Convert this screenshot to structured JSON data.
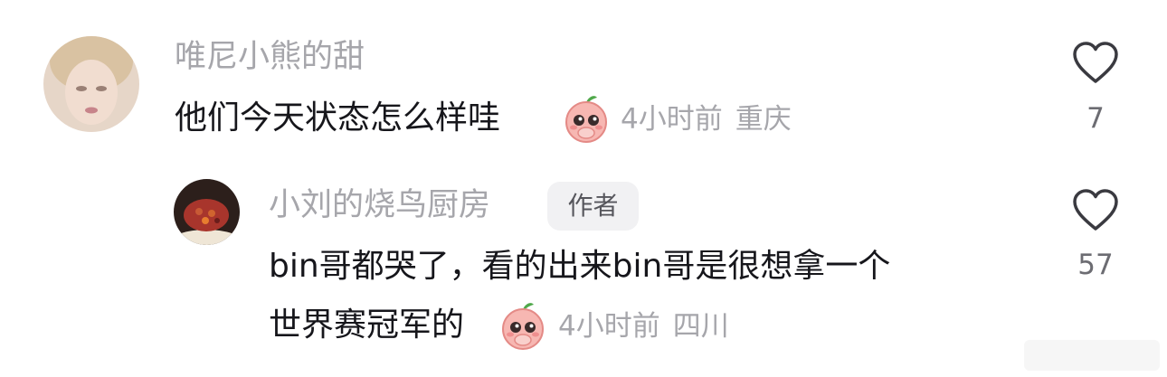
{
  "comments": [
    {
      "username": "唯尼小熊的甜",
      "text": "他们今天状态怎么样哇",
      "emoji_icon": "peach-shy-emoji",
      "time": "4小时前",
      "location": "重庆",
      "like_count": "7"
    }
  ],
  "reply": {
    "username": "小刘的烧鸟厨房",
    "badge": "作者",
    "text_line1": "bin哥都哭了，看的出来bin哥是很想拿一个",
    "text_line2": "世界赛冠军的",
    "emoji_icon": "peach-shy-emoji",
    "time": "4小时前",
    "location": "四川",
    "like_count": "57"
  },
  "colors": {
    "text_primary": "#16161b",
    "text_secondary": "#a6a6ab",
    "badge_bg": "#f1f1f3",
    "heart_stroke": "#3a3a40"
  }
}
